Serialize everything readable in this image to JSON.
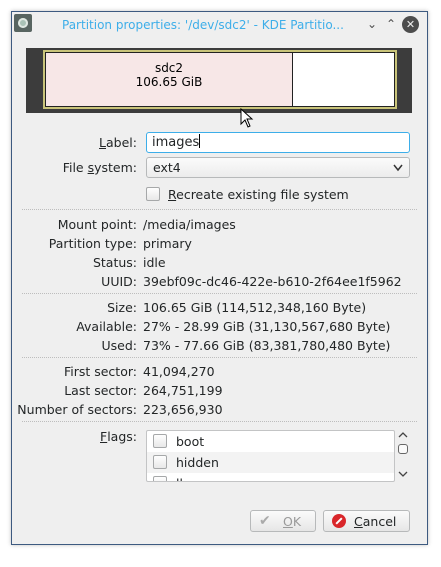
{
  "window": {
    "title": "Partition properties: '/dev/sdc2' - KDE Partitio...",
    "minimize_glyph": "⌄",
    "maximize_glyph": "⌃",
    "close_glyph": "✕"
  },
  "partition_map": {
    "name": "sdc2",
    "size": "106.65 GiB",
    "used_fraction": 0.7
  },
  "form": {
    "label_caption_pre": "",
    "label_caption_accel": "L",
    "label_caption_post": "abel:",
    "label_value": "images",
    "fs_caption_pre": "File ",
    "fs_caption_accel": "s",
    "fs_caption_post": "ystem:",
    "fs_value": "ext4",
    "recreate_accel": "R",
    "recreate_rest": "ecreate existing file system"
  },
  "info": {
    "mount_point_label": "Mount point:",
    "mount_point": "/media/images",
    "partition_type_label": "Partition type:",
    "partition_type": "primary",
    "status_label": "Status:",
    "status": "idle",
    "uuid_label": "UUID:",
    "uuid": "39ebf09c-dc46-422e-b610-2f64ee1f5962",
    "size_label": "Size:",
    "size": "106.65 GiB (114,512,348,160 Byte)",
    "available_label": "Available:",
    "available": "27% - 28.99 GiB (31,130,567,680 Byte)",
    "used_label": "Used:",
    "used": "73% - 77.66 GiB (83,381,780,480 Byte)",
    "first_sector_label": "First sector:",
    "first_sector": "41,094,270",
    "last_sector_label": "Last sector:",
    "last_sector": "264,751,199",
    "num_sectors_label": "Number of sectors:",
    "num_sectors": "223,656,930"
  },
  "flags": {
    "caption_accel": "F",
    "caption_rest": "lags:",
    "items": [
      {
        "label": "boot"
      },
      {
        "label": "hidden"
      },
      {
        "label": "lba"
      }
    ]
  },
  "buttons": {
    "ok_accel": "O",
    "ok_rest": "K",
    "cancel_accel": "C",
    "cancel_rest": "ancel"
  },
  "colors": {
    "accent": "#3daee9",
    "partition_fill": "#f7e7e7",
    "cancel_red": "#d9262a"
  }
}
